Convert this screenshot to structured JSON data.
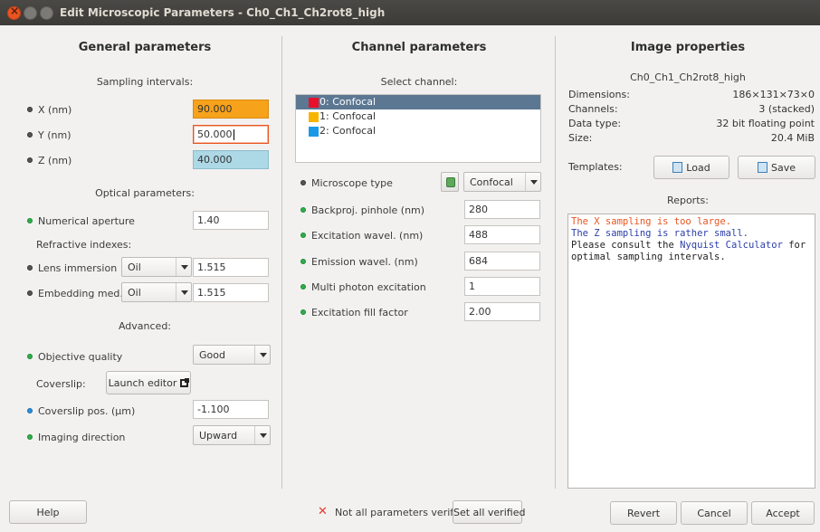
{
  "window": {
    "title": "Edit Microscopic Parameters - Ch0_Ch1_Ch2rot8_high"
  },
  "general": {
    "heading": "General parameters",
    "sampling_heading": "Sampling intervals:",
    "x_label": "X (nm)",
    "x_value": "90.000",
    "y_label": "Y (nm)",
    "y_value": "50.000",
    "z_label": "Z (nm)",
    "z_value": "40.000",
    "optical_heading": "Optical parameters:",
    "na_label": "Numerical aperture",
    "na_value": "1.40",
    "ri_heading": "Refractive indexes:",
    "lens_label": "Lens immersion",
    "lens_medium": "Oil",
    "lens_value": "1.515",
    "embed_label": "Embedding med.",
    "embed_medium": "Oil",
    "embed_value": "1.515",
    "advanced_heading": "Advanced:",
    "objq_label": "Objective quality",
    "objq_value": "Good",
    "coverslip_label": "Coverslip:",
    "coverslip_button": "Launch editor",
    "coverpos_label": "Coverslip pos. (µm)",
    "coverpos_value": "-1.100",
    "imgdir_label": "Imaging direction",
    "imgdir_value": "Upward"
  },
  "channel": {
    "heading": "Channel parameters",
    "select_label": "Select channel:",
    "channels": [
      {
        "label": "0: Confocal",
        "color": "#e8102b"
      },
      {
        "label": "1: Confocal",
        "color": "#f7b500"
      },
      {
        "label": "2: Confocal",
        "color": "#1a9ae6"
      }
    ],
    "microscope_label": "Microscope type",
    "microscope_value": "Confocal",
    "pinhole_label": "Backproj. pinhole (nm)",
    "pinhole_value": "280",
    "exc_label": "Excitation wavel. (nm)",
    "exc_value": "488",
    "em_label": "Emission wavel. (nm)",
    "em_value": "684",
    "mp_label": "Multi photon excitation",
    "mp_value": "1",
    "fill_label": "Excitation fill factor",
    "fill_value": "2.00"
  },
  "image": {
    "heading": "Image properties",
    "name": "Ch0_Ch1_Ch2rot8_high",
    "dimensions_label": "Dimensions:",
    "dimensions_value": "186×131×73×0",
    "channels_label": "Channels:",
    "channels_value": "3 (stacked)",
    "datatype_label": "Data type:",
    "datatype_value": "32 bit floating point",
    "size_label": "Size:",
    "size_value": "20.4 MiB",
    "templates_label": "Templates:",
    "load_button": "Load",
    "save_button": "Save",
    "reports_heading": "Reports:",
    "report_line1": "The X sampling is too large.",
    "report_line2": "The Z sampling is rather small.",
    "report_line3_pre": "Please consult the ",
    "report_link": "Nyquist Calculator",
    "report_line3_post": " for",
    "report_line4": "optimal sampling intervals."
  },
  "footer": {
    "help": "Help",
    "status": "Not all parameters verified",
    "set_verified": "Set all verified",
    "revert": "Revert",
    "cancel": "Cancel",
    "accept": "Accept"
  },
  "colors": {
    "accent": "#e95420",
    "selection": "#5c7792",
    "warn_field": "#f7a21b",
    "info_field": "#add8e6"
  }
}
